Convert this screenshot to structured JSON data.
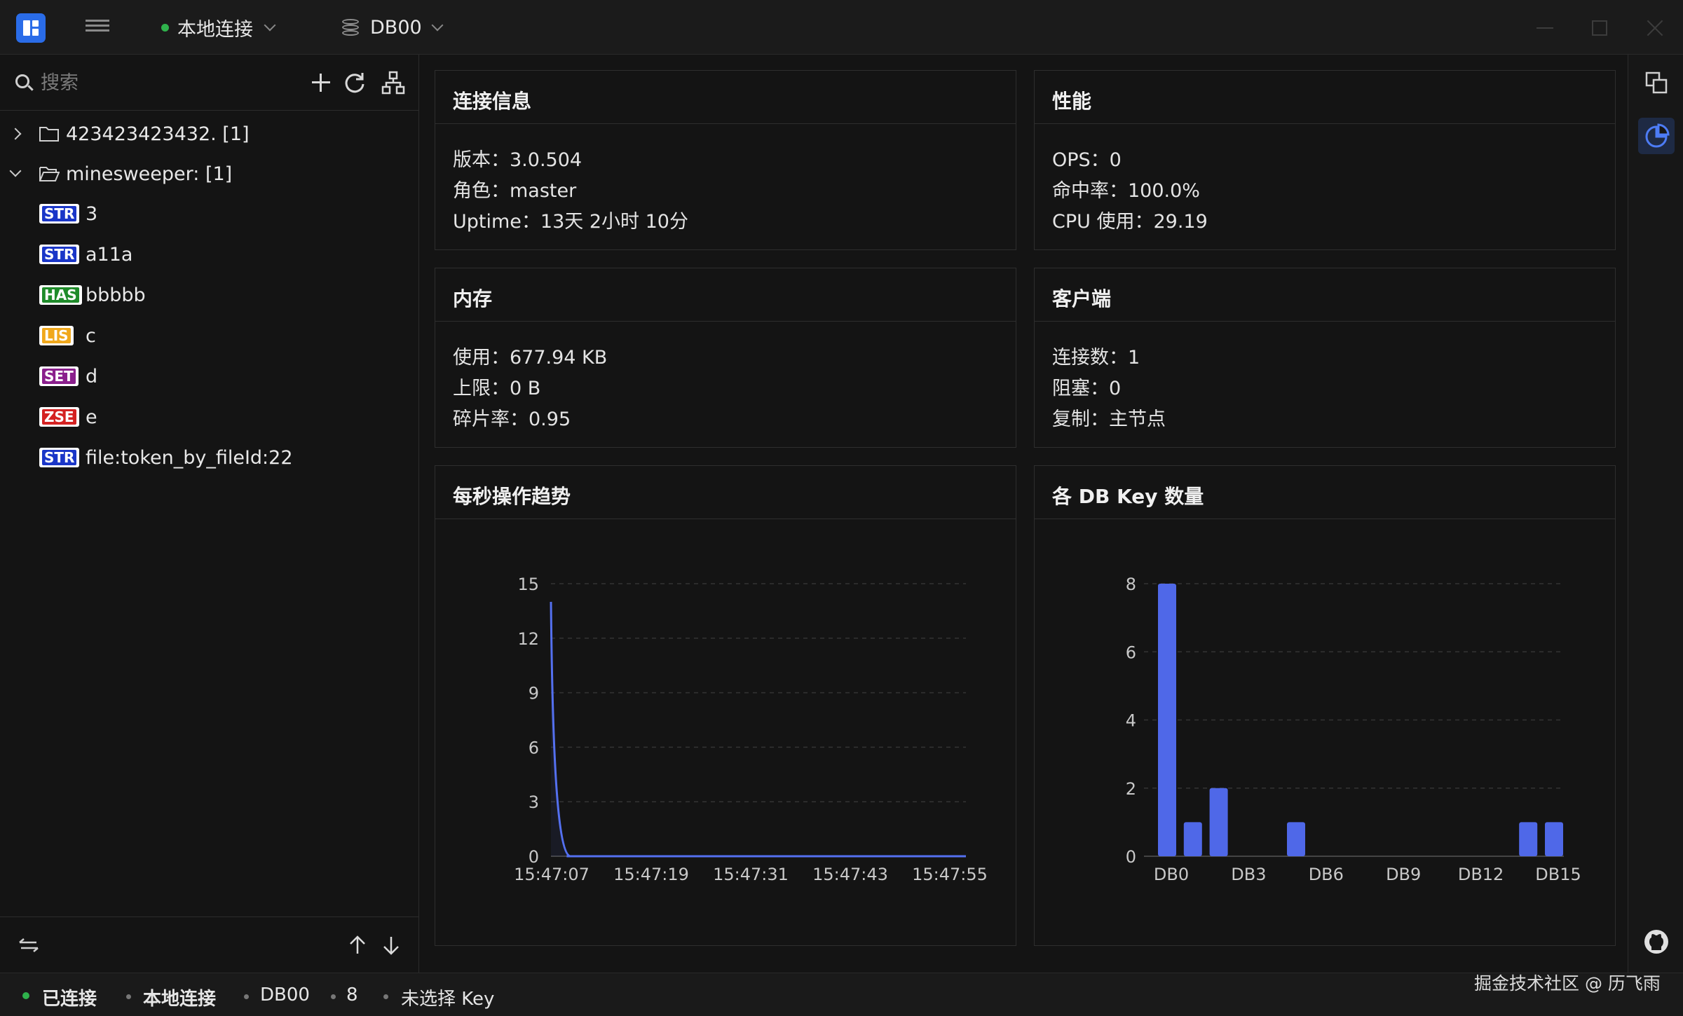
{
  "titlebar": {
    "connection": "本地连接",
    "database": "DB00"
  },
  "sidebar": {
    "search_placeholder": "搜索",
    "folders": [
      {
        "label": "423423423432. [1]",
        "expanded": false
      },
      {
        "label": "minesweeper: [1]",
        "expanded": true
      }
    ],
    "keys": [
      {
        "type": "STR",
        "name": "3",
        "color": "#1a36c8"
      },
      {
        "type": "STR",
        "name": "a11a",
        "color": "#1a36c8"
      },
      {
        "type": "HAS",
        "name": "bbbbb",
        "color": "#1f8b2a"
      },
      {
        "type": "LIS",
        "name": "c",
        "color": "#f0a81c"
      },
      {
        "type": "SET",
        "name": "d",
        "color": "#8a1f8c"
      },
      {
        "type": "ZSE",
        "name": "e",
        "color": "#d42222"
      },
      {
        "type": "STR",
        "name": "file:token_by_fileId:22",
        "color": "#1a36c8"
      }
    ]
  },
  "panels": {
    "connection": {
      "title": "连接信息",
      "version": "版本：3.0.504",
      "role": "角色：master",
      "uptime": "Uptime：13天 2小时 10分"
    },
    "performance": {
      "title": "性能",
      "ops": "OPS：0",
      "hit_rate": "命中率：100.0%",
      "cpu": "CPU 使用：29.19"
    },
    "memory": {
      "title": "内存",
      "used": "使用：677.94 KB",
      "limit": "上限：0 B",
      "fragmentation": "碎片率：0.95"
    },
    "clients": {
      "title": "客户端",
      "connections": "连接数：1",
      "blocked": "阻塞：0",
      "replication": "复制：主节点"
    },
    "ops_trend": {
      "title": "每秒操作趋势"
    },
    "db_keys": {
      "title": "各 DB Key 数量"
    }
  },
  "chart_data": [
    {
      "type": "area",
      "title": "每秒操作趋势",
      "x_ticks": [
        "15:47:07",
        "15:47:19",
        "15:47:31",
        "15:47:43",
        "15:47:55"
      ],
      "y_ticks": [
        0,
        3,
        6,
        9,
        12,
        15
      ],
      "ylim": [
        0,
        15
      ],
      "series": [
        {
          "values": [
            14,
            0,
            0,
            0,
            0,
            0,
            0,
            0,
            0,
            0,
            0,
            0,
            0,
            0,
            0,
            0,
            0,
            0,
            0,
            0,
            0,
            0,
            0,
            0,
            0,
            0,
            0,
            0,
            0,
            0,
            0,
            0,
            0,
            0,
            0,
            0,
            0,
            0,
            0,
            0,
            0,
            0,
            0,
            0,
            0,
            0,
            0,
            0,
            0,
            0,
            0,
            0,
            0,
            0
          ]
        }
      ],
      "line_color": "#5470f0",
      "grid": true
    },
    {
      "type": "bar",
      "title": "各 DB Key 数量",
      "categories": [
        "DB0",
        "DB1",
        "DB2",
        "DB3",
        "DB4",
        "DB5",
        "DB6",
        "DB7",
        "DB8",
        "DB9",
        "DB10",
        "DB11",
        "DB12",
        "DB13",
        "DB14",
        "DB15"
      ],
      "tick_labels": [
        "DB0",
        "DB3",
        "DB6",
        "DB9",
        "DB12",
        "DB15"
      ],
      "values": [
        8,
        1,
        2,
        0,
        0,
        1,
        0,
        0,
        0,
        0,
        0,
        0,
        0,
        0,
        1,
        1
      ],
      "y_ticks": [
        0,
        2,
        4,
        6,
        8
      ],
      "ylim": [
        0,
        8
      ],
      "bar_color": "#4f68e8",
      "grid": true
    }
  ],
  "statusbar": {
    "status": "已连接",
    "connection": "本地连接",
    "database": "DB00",
    "key_count": "8",
    "selection": "未选择 Key"
  },
  "watermark": "掘金技术社区 @ 历飞雨"
}
